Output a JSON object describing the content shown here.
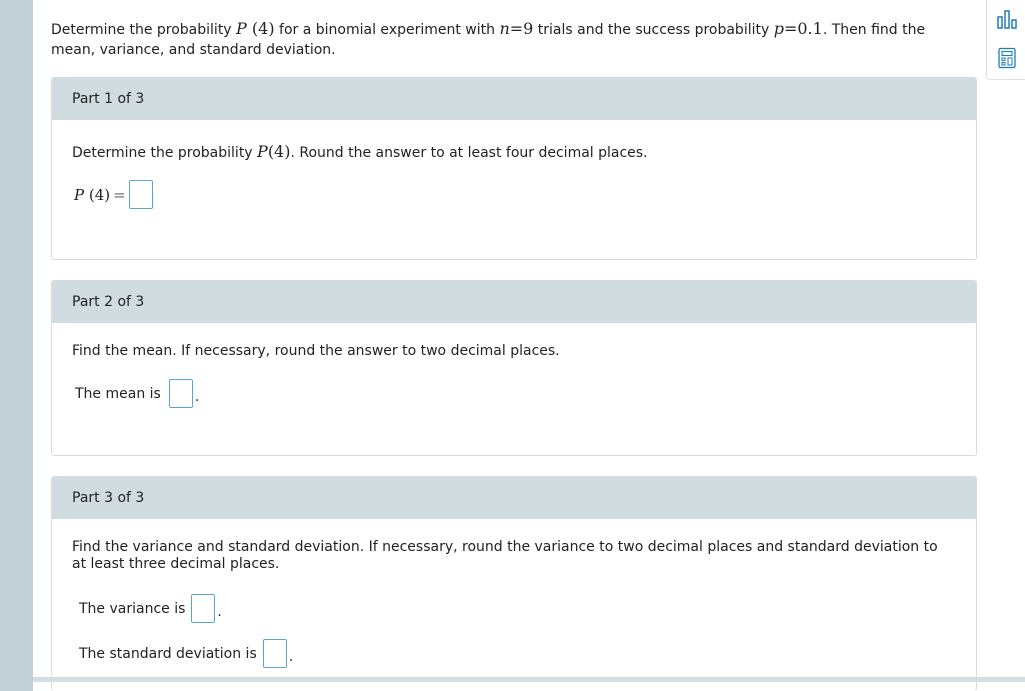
{
  "question": {
    "t1": "Determine the probability ",
    "m1": "P",
    "m2": "(4)",
    "t2": " for a binomial experiment with ",
    "m3": "n",
    "m4": "=9",
    "t3": " trials and the success probability ",
    "m5": "p",
    "m6": "=0.1",
    "t4": ". Then find the",
    "t5": "mean, variance, and standard deviation."
  },
  "tools": {
    "chart_icon": "bar-chart-icon",
    "calc_icon": "calculator-icon",
    "accent": "#1f7db5"
  },
  "part1": {
    "header": "Part 1 of 3",
    "prompt_a": "Determine the probability ",
    "prompt_m1": "P",
    "prompt_m2": "(4)",
    "prompt_b": ". Round the answer to at least four decimal places.",
    "answer_m1": "P",
    "answer_m2": "(4)",
    "answer_eq": "="
  },
  "part2": {
    "header": "Part 2 of 3",
    "prompt": "Find the mean. If necessary, round the answer to two decimal places.",
    "answer_label": "The mean is",
    "answer_end": "."
  },
  "part3": {
    "header": "Part 3 of 3",
    "prompt": "Find the variance and standard deviation. If necessary, round the variance to two decimal places and standard deviation to at least three decimal places.",
    "variance_label": "The variance is",
    "variance_end": ".",
    "sd_label": "The standard deviation is",
    "sd_end": "."
  },
  "colors": {
    "card_header": "#d1dce1",
    "input_border": "#5aa6cf",
    "left_rail": "#c3d0d6"
  }
}
